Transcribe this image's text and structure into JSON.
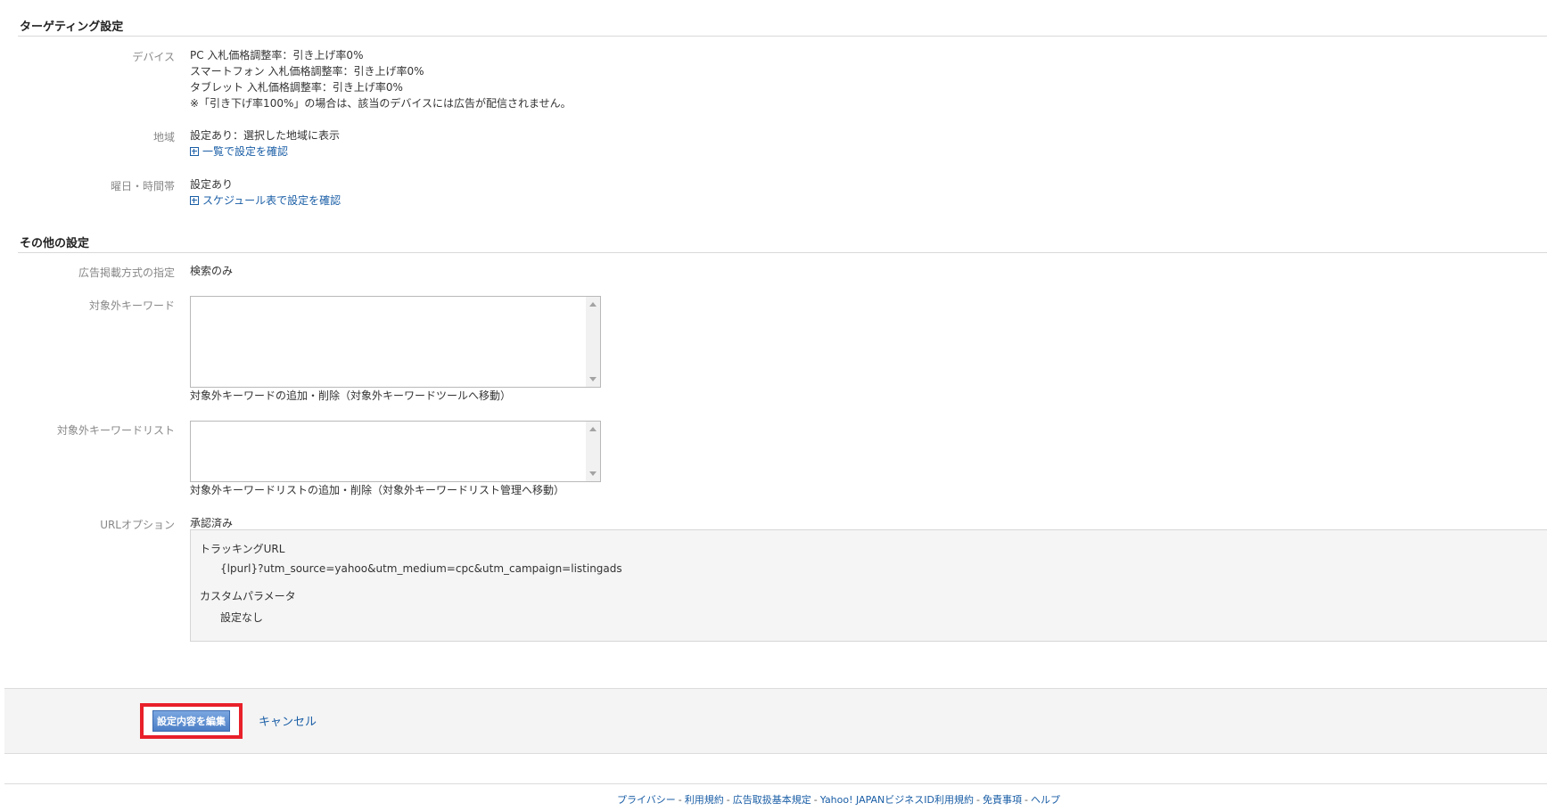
{
  "targeting": {
    "title": "ターゲティング設定",
    "device": {
      "label": "デバイス",
      "lines": [
        "PC 入札価格調整率：引き上げ率0%",
        "スマートフォン 入札価格調整率：引き上げ率0%",
        "タブレット 入札価格調整率：引き上げ率0%",
        "※「引き下げ率100%」の場合は、該当のデバイスには広告が配信されません。"
      ]
    },
    "region": {
      "label": "地域",
      "value": "設定あり：選択した地域に表示",
      "link": "一覧で設定を確認"
    },
    "schedule": {
      "label": "曜日・時間帯",
      "value": "設定あり",
      "link": "スケジュール表で設定を確認"
    }
  },
  "other": {
    "title": "その他の設定",
    "ad_display": {
      "label": "広告掲載方式の指定",
      "value": "検索のみ"
    },
    "negative_keywords": {
      "label": "対象外キーワード",
      "value": "",
      "link": "対象外キーワードの追加・削除（対象外キーワードツールへ移動）"
    },
    "negative_keyword_list": {
      "label": "対象外キーワードリスト",
      "value": "",
      "link": "対象外キーワードリストの追加・削除（対象外キーワードリスト管理へ移動）"
    },
    "url_option": {
      "label": "URLオプション",
      "status": "承認済み",
      "tracking_title": "トラッキングURL",
      "tracking_value": "{lpurl}?utm_source=yahoo&utm_medium=cpc&utm_campaign=listingads",
      "custom_title": "カスタムパラメータ",
      "custom_value": "設定なし"
    }
  },
  "actions": {
    "edit_label": "設定内容を編集",
    "cancel_label": "キャンセル",
    "highlight_color": "#e8202a"
  },
  "footer": {
    "links": [
      "プライバシー",
      "利用規約",
      "広告取扱基本規定",
      "Yahoo! JAPANビジネスID利用規約",
      "免責事項",
      "ヘルプ"
    ],
    "separator": "-"
  }
}
